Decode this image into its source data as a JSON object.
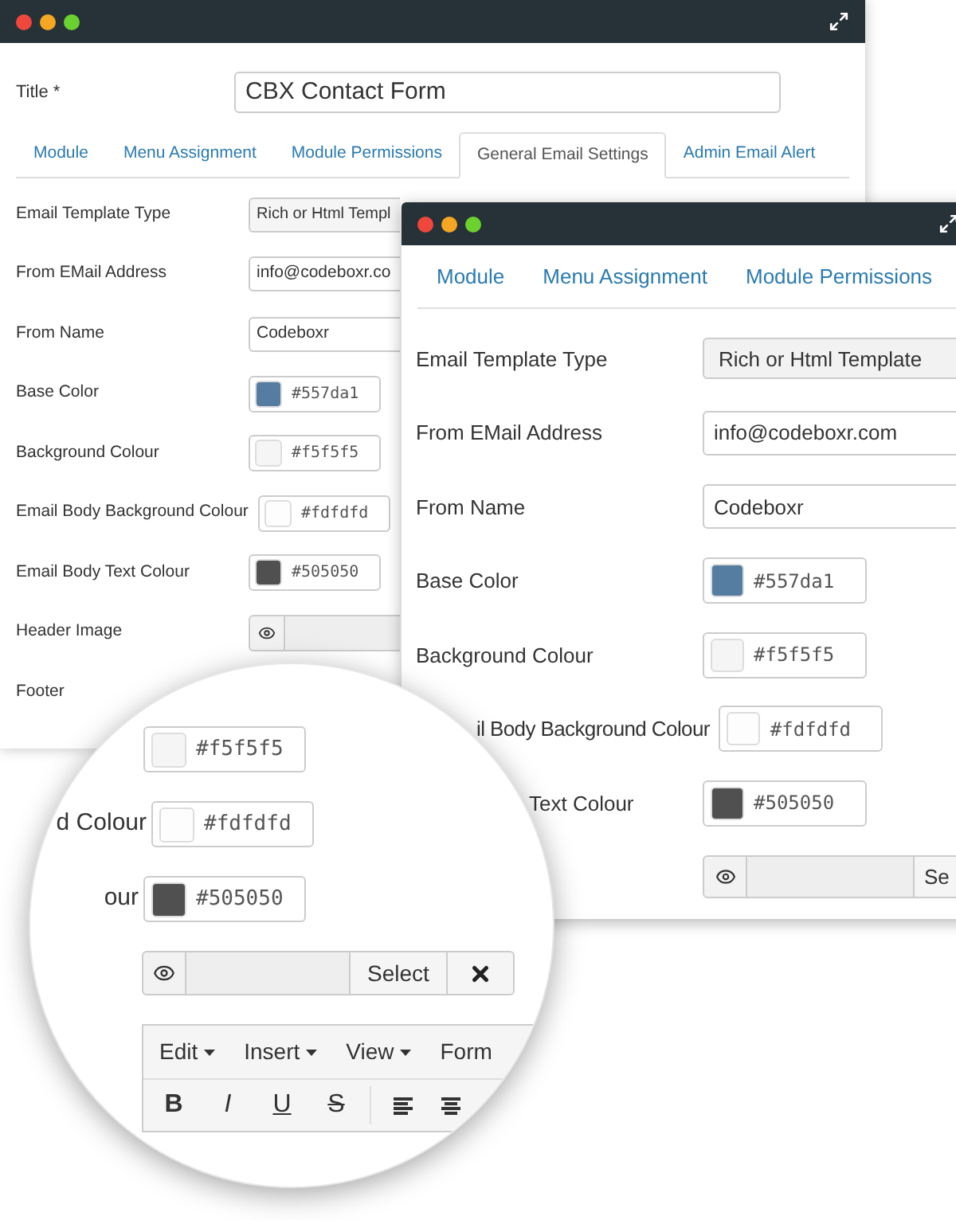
{
  "back_window": {
    "title_field": {
      "label": "Title *",
      "value": "CBX Contact Form"
    },
    "tabs": [
      {
        "label": "Module",
        "selected": false
      },
      {
        "label": "Menu Assignment",
        "selected": false
      },
      {
        "label": "Module Permissions",
        "selected": false
      },
      {
        "label": "General Email Settings",
        "selected": true
      },
      {
        "label": "Admin Email Alert",
        "selected": false
      }
    ],
    "rows": [
      {
        "kind": "select",
        "label": "Email Template Type",
        "value": "Rich or Html Templ"
      },
      {
        "kind": "text",
        "label": "From EMail Address",
        "value": "info@codeboxr.co"
      },
      {
        "kind": "text",
        "label": "From Name",
        "value": "Codeboxr"
      },
      {
        "kind": "color",
        "label": "Base Color",
        "value": "#557da1",
        "color": "#557da1"
      },
      {
        "kind": "color",
        "label": "Background Colour",
        "value": "#f5f5f5",
        "color": "#f5f5f5"
      },
      {
        "kind": "color",
        "label": "Email Body Background Colour",
        "value": "#fdfdfd",
        "color": "#fdfdfd"
      },
      {
        "kind": "color",
        "label": "Email Body Text Colour",
        "value": "#505050",
        "color": "#505050"
      },
      {
        "kind": "image",
        "label": "Header Image"
      },
      {
        "kind": "label",
        "label": "Footer"
      }
    ]
  },
  "front_window": {
    "tabs": [
      {
        "label": "Module",
        "selected": false
      },
      {
        "label": "Menu Assignment",
        "selected": false
      },
      {
        "label": "Module Permissions",
        "selected": false
      }
    ],
    "rows": [
      {
        "kind": "select",
        "label": "Email Template Type",
        "value": "Rich or Html Template"
      },
      {
        "kind": "text",
        "label": "From EMail Address",
        "value": "info@codeboxr.com"
      },
      {
        "kind": "text",
        "label": "From Name",
        "value": "Codeboxr"
      },
      {
        "kind": "color",
        "label": "Base Color",
        "value": "#557da1",
        "color": "#557da1"
      },
      {
        "kind": "color",
        "label": "Background Colour",
        "value": "#f5f5f5",
        "color": "#f5f5f5"
      },
      {
        "kind": "color",
        "label": "il Body Background Colour",
        "value": "#fdfdfd",
        "color": "#fdfdfd"
      },
      {
        "kind": "color",
        "label": "Text Colour",
        "value": "#505050",
        "color": "#505050"
      },
      {
        "kind": "image",
        "select_button": "Se"
      }
    ]
  },
  "magnifier": {
    "rows": [
      {
        "kind": "color",
        "value": "#f5f5f5",
        "color": "#f5f5f5"
      },
      {
        "kind": "color",
        "label": "d Colour",
        "value": "#fdfdfd",
        "color": "#fdfdfd"
      },
      {
        "kind": "color",
        "label": "our",
        "value": "#505050",
        "color": "#505050"
      },
      {
        "kind": "image",
        "select_button": "Select"
      }
    ],
    "editor": {
      "menus": [
        {
          "label": "Edit",
          "caret": true
        },
        {
          "label": "Insert",
          "caret": true
        },
        {
          "label": "View",
          "caret": true
        },
        {
          "label": "Form",
          "caret": false
        }
      ],
      "toolbar": [
        {
          "kind": "bold",
          "label": "B"
        },
        {
          "kind": "italic",
          "label": "I"
        },
        {
          "kind": "underline",
          "label": "U"
        },
        {
          "kind": "strike",
          "label": "S"
        },
        {
          "kind": "divider"
        },
        {
          "kind": "align-left"
        },
        {
          "kind": "align-center"
        }
      ]
    }
  }
}
